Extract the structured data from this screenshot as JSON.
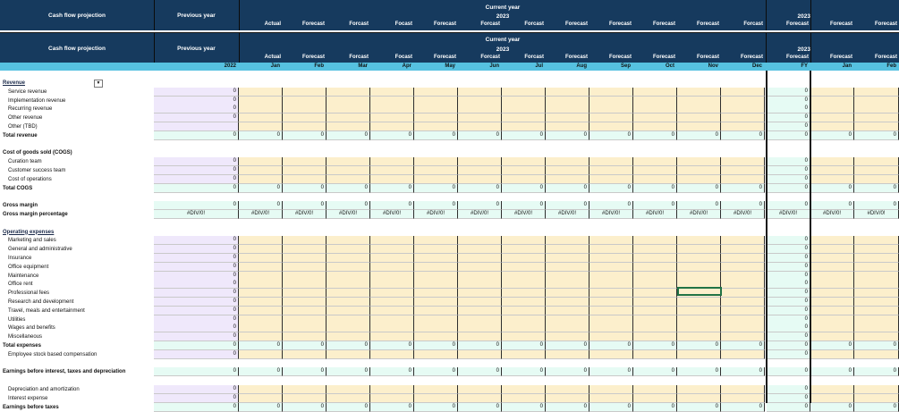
{
  "header": {
    "title": "Cash flow projection",
    "previous_year": "Previous year",
    "current_year": "Current year",
    "year": "2023",
    "year_prev": "2022",
    "top_months": [
      "Actual",
      "Forecast",
      "Forcast",
      "Focast",
      "Forecast",
      "Forcast",
      "Forcast",
      "Forecast",
      "Forecast",
      "Forecast",
      "Forecast",
      "Forcast"
    ],
    "months_type": [
      "Actual",
      "Forecast",
      "Forcast",
      "Focast",
      "Forecast",
      "Forcast",
      "Forcast",
      "Forecast",
      "Forecast",
      "Forecast",
      "Forecast",
      "Forecast"
    ],
    "months": [
      "Jan",
      "Feb",
      "Mar",
      "Apr",
      "May",
      "Jun",
      "Jul",
      "Aug",
      "Sep",
      "Oct",
      "Nov",
      "Dec"
    ],
    "fy_label": "Forecast",
    "fy": "FY",
    "next_labels": [
      "Forecast",
      "Forecast"
    ],
    "next_months": [
      "Jan",
      "Feb"
    ]
  },
  "dropdown_icon": "chevron-down-icon",
  "rows": [
    {
      "label": "Revenue",
      "type": "section"
    },
    {
      "label": "Service revenue",
      "type": "item",
      "prev": "0",
      "fy": "0"
    },
    {
      "label": "Implementation revenue",
      "type": "item",
      "prev": "0",
      "fy": "0"
    },
    {
      "label": "Recurring revenue",
      "type": "item",
      "prev": "0",
      "fy": "0"
    },
    {
      "label": "Other revenue",
      "type": "item",
      "prev": "0",
      "fy": "0"
    },
    {
      "label": "Other (TBD)",
      "type": "item",
      "prev": "",
      "fy": "0"
    },
    {
      "label": "Total revenue",
      "type": "total",
      "prev": "0",
      "val": "0"
    },
    {
      "label": "",
      "type": "blank"
    },
    {
      "label": "Cost of goods sold (COGS)",
      "type": "header"
    },
    {
      "label": "Curation team",
      "type": "item",
      "prev": "0",
      "fy": "0"
    },
    {
      "label": "Customer success team",
      "type": "item",
      "prev": "0",
      "fy": "0"
    },
    {
      "label": "Cost of operations",
      "type": "item",
      "prev": "0",
      "fy": "0"
    },
    {
      "label": "Total COGS",
      "type": "total",
      "prev": "0",
      "val": "0"
    },
    {
      "label": "",
      "type": "blank"
    },
    {
      "label": "Gross margin",
      "type": "total",
      "prev": "0",
      "val": "0"
    },
    {
      "label": "Gross margin percentage",
      "type": "error",
      "prev": "#DIV/0!",
      "val": "#DIV/0!"
    },
    {
      "label": "",
      "type": "blank"
    },
    {
      "label": "Operating expenses",
      "type": "section"
    },
    {
      "label": "Marketing and sales",
      "type": "item",
      "prev": "0",
      "fy": "0"
    },
    {
      "label": "General and administrative",
      "type": "item",
      "prev": "0",
      "fy": "0"
    },
    {
      "label": "Insurance",
      "type": "item",
      "prev": "0",
      "fy": "0"
    },
    {
      "label": "Office equipment",
      "type": "item",
      "prev": "0",
      "fy": "0"
    },
    {
      "label": "Maintenance",
      "type": "item",
      "prev": "0",
      "fy": "0"
    },
    {
      "label": "Office rent",
      "type": "item",
      "prev": "0",
      "fy": "0"
    },
    {
      "label": "Professional fees",
      "type": "item",
      "prev": "0",
      "fy": "0"
    },
    {
      "label": "Research and development",
      "type": "item",
      "prev": "0",
      "fy": "0"
    },
    {
      "label": "Travel, meals and entertainment",
      "type": "item",
      "prev": "0",
      "fy": "0"
    },
    {
      "label": "Utilities",
      "type": "item",
      "prev": "0",
      "fy": "0"
    },
    {
      "label": "Wages and benefits",
      "type": "item",
      "prev": "0",
      "fy": "0"
    },
    {
      "label": "Miscellaneous",
      "type": "item",
      "prev": "0",
      "fy": "0"
    },
    {
      "label": "Total expenses",
      "type": "total",
      "prev": "0",
      "val": "0"
    },
    {
      "label": "Employee stock based compensation",
      "type": "item",
      "prev": "0",
      "fy": "0"
    },
    {
      "label": "",
      "type": "blank"
    },
    {
      "label": "Earnings before interest, taxes and depreciation",
      "type": "total",
      "prev": "0",
      "val": "0"
    },
    {
      "label": "",
      "type": "blank"
    },
    {
      "label": "Depreciation and amortization",
      "type": "item",
      "prev": "0",
      "fy": "0"
    },
    {
      "label": "Interest expense",
      "type": "item",
      "prev": "0",
      "fy": "0"
    },
    {
      "label": "Earnings before taxes",
      "type": "total",
      "prev": "0",
      "val": "0"
    }
  ]
}
